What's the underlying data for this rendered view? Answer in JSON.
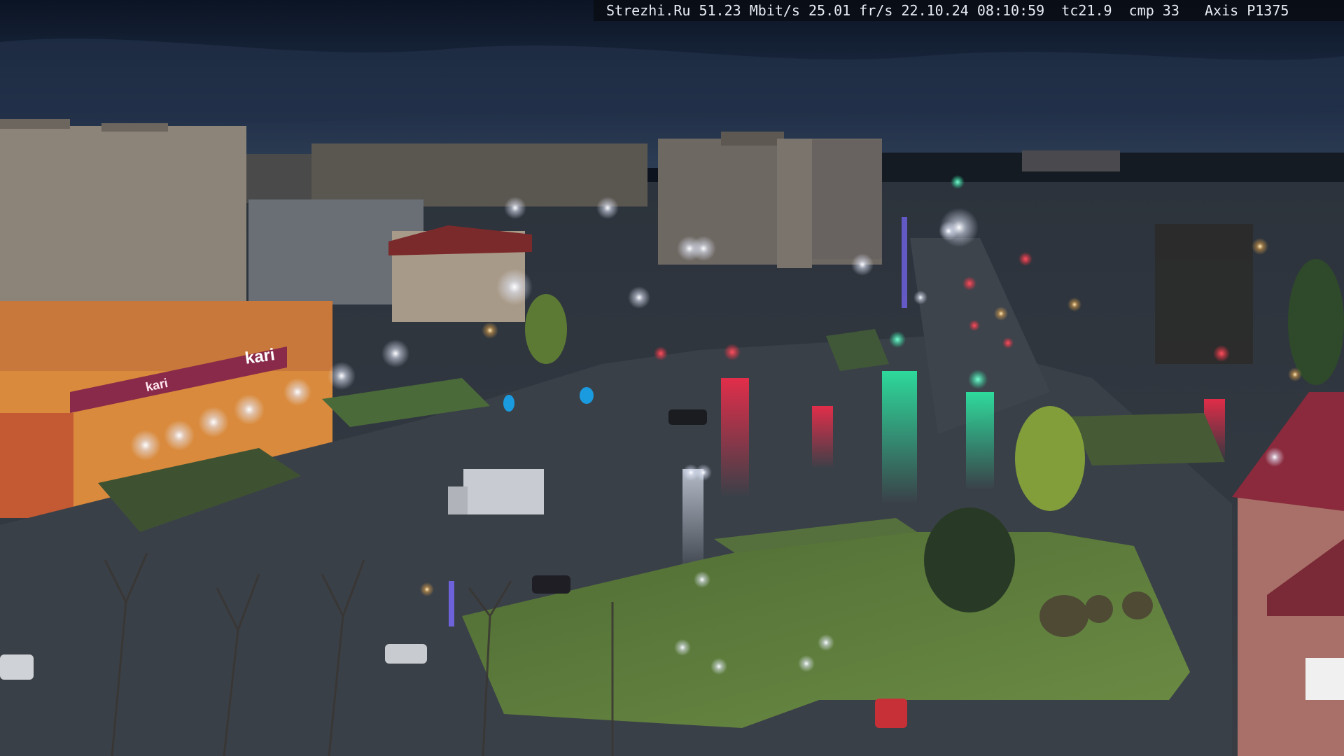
{
  "osd": {
    "site": "Strezhi.Ru",
    "bitrate": "51.23 Mbit/s",
    "framerate": "25.01 fr/s",
    "date": "22.10.24",
    "time": "08:10:59",
    "tc": "tc21.9",
    "cmp": "cmp 33",
    "camera": "Axis P1375"
  },
  "signs": {
    "store_logo": "kari",
    "store_logo_small": "kari"
  },
  "colors": {
    "sky_top": "#0b1424",
    "sky_mid": "#1d2c44",
    "sky_horizon": "#2b3b52",
    "road": "#3a4048",
    "grass": "#5a7a3a",
    "lamp_glow": "#f4f2ff",
    "signal_red": "#ff2a3a",
    "signal_green": "#21e6a0",
    "store_orange": "#d98a3c",
    "store_sign": "#8a2a4a"
  }
}
